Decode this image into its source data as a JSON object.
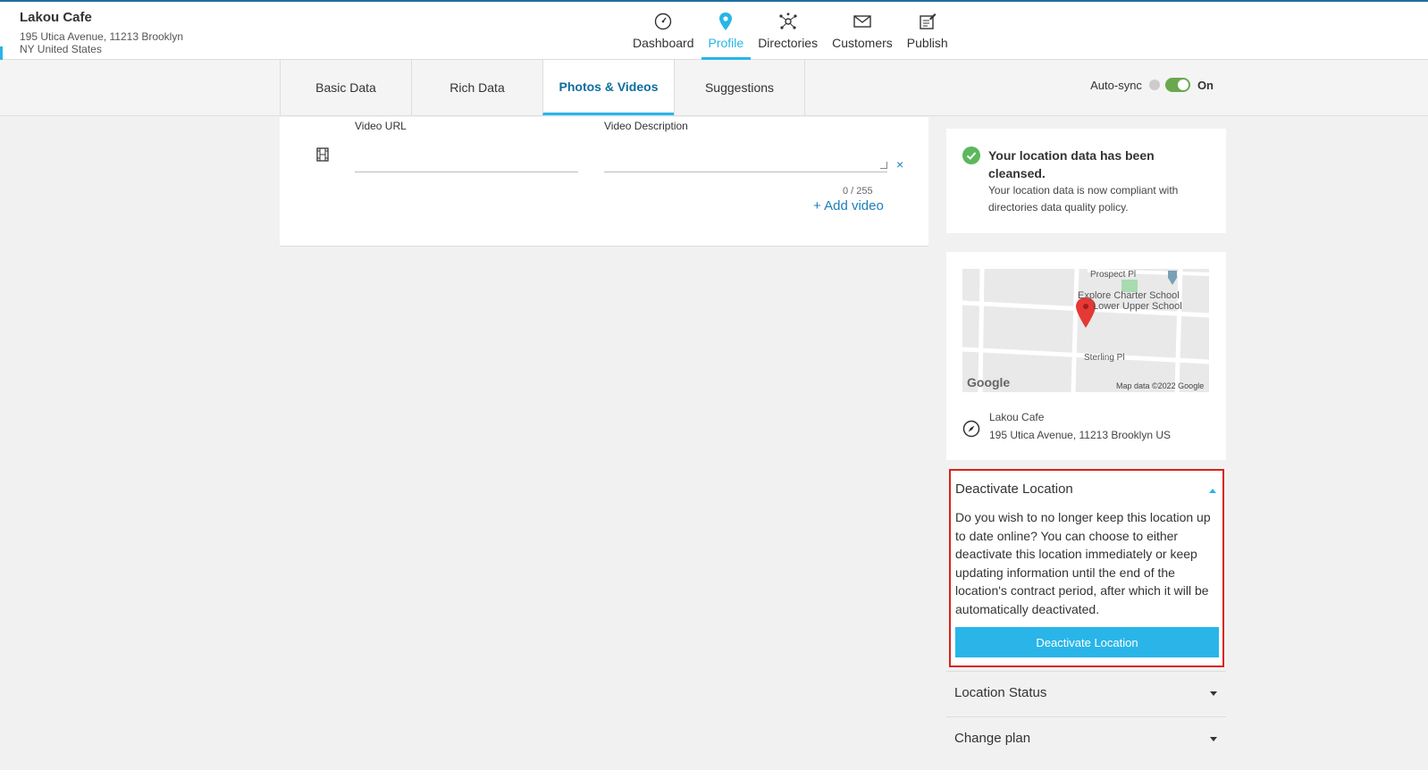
{
  "location": {
    "name": "Lakou Cafe",
    "address_line1": "195 Utica Avenue, 11213 Brooklyn",
    "address_line2": "NY United States"
  },
  "nav": [
    {
      "label": "Dashboard",
      "icon": "gauge-icon"
    },
    {
      "label": "Profile",
      "icon": "map-pin-icon",
      "active": true
    },
    {
      "label": "Directories",
      "icon": "network-icon"
    },
    {
      "label": "Customers",
      "icon": "envelope-icon"
    },
    {
      "label": "Publish",
      "icon": "edit-note-icon"
    }
  ],
  "tabs": [
    {
      "label": "Basic Data"
    },
    {
      "label": "Rich Data"
    },
    {
      "label": "Photos & Videos",
      "active": true
    },
    {
      "label": "Suggestions"
    }
  ],
  "autosync": {
    "label": "Auto-sync",
    "state": "On"
  },
  "video_form": {
    "url_label": "Video URL",
    "url_value": "",
    "description_label": "Video Description",
    "description_value": "",
    "counter": "0 / 255",
    "add_label": "+ Add video",
    "remove_symbol": "×"
  },
  "cleansed": {
    "title": "Your location data has been cleansed.",
    "text": "Your location data is now compliant with directories data quality policy."
  },
  "map": {
    "labels": [
      "Prospect Pl",
      "Explore Charter School",
      "Lower Upper School",
      "Sterling Pl"
    ],
    "google": "Google",
    "attribution": "Map data ©2022 Google",
    "place_name": "Lakou Cafe",
    "place_address": "195 Utica Avenue, 11213 Brooklyn US"
  },
  "deactivate": {
    "title": "Deactivate Location",
    "text": "Do you wish to no longer keep this location up to date online? You can choose to either deactivate this location immediately or keep updating information until the end of the location's contract period, after which it will be automatically deactivated.",
    "button": "Deactivate Location"
  },
  "accordions": [
    {
      "title": "Location Status"
    },
    {
      "title": "Change plan"
    }
  ],
  "colors": {
    "accent": "#29b5e8",
    "highlight_border": "#d9221c",
    "toggle_on": "#6aa84f"
  }
}
